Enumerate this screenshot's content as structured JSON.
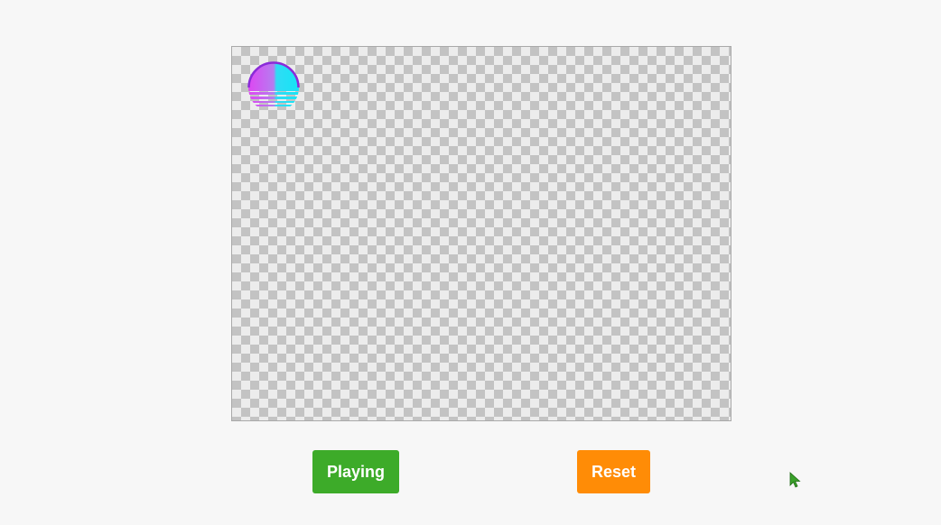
{
  "colors": {
    "play_button": "#3dab29",
    "reset_button": "#ff8c06",
    "checker_dark": "#c3c3c3",
    "checker_light": "#ececec",
    "cursor": "#3aa12a"
  },
  "stage": {
    "sprite_icon": "sunset-logo-icon"
  },
  "controls": {
    "play_label": "Playing",
    "reset_label": "Reset"
  }
}
